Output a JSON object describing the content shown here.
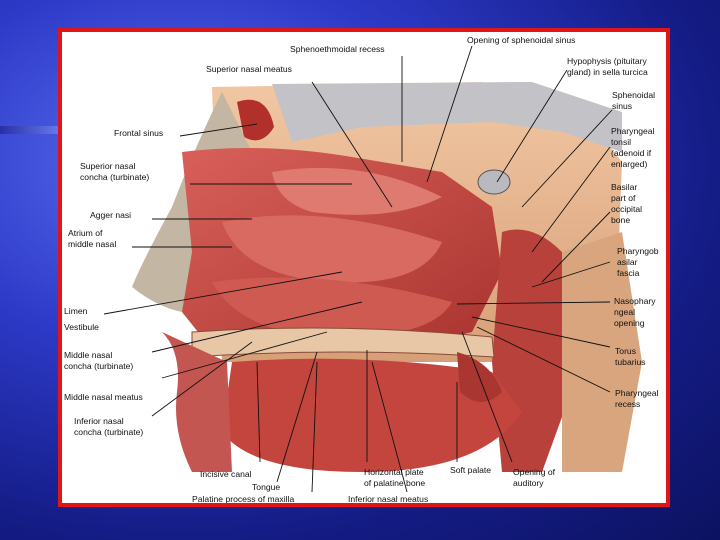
{
  "labels": {
    "sphenoethmoidal_recess": "Sphenoethmoidal recess",
    "opening_sphenoidal_sinus": "Opening of sphenoidal sinus",
    "superior_nasal_meatus": "Superior nasal meatus",
    "hypophysis": "Hypophysis (pituitary\ngland) in sella turcica",
    "sphenoidal_sinus": "Sphenoidal\nsinus",
    "frontal_sinus": "Frontal sinus",
    "pharyngeal_tonsil": "Pharyngeal\ntonsil\n(adenoid if\nenlarged)",
    "superior_nasal_concha": "Superior nasal\nconcha (turbinate)",
    "basilar_part": "Basilar\npart of\noccipital\nbone",
    "agger_nasi": "Agger nasi",
    "atrium_middle_nasal": "Atrium of\nmiddle nasal",
    "pharyngobasilar_fascia": "Pharyngob\nasilar\nfascia",
    "limen": "Limen",
    "vestibule": "Vestibule",
    "nasopharyngeal_opening": "Nasophary\nngeal\nopening",
    "middle_nasal_concha": "Middle nasal\nconcha (turbinate)",
    "torus_tubarius": "Torus\ntubarius",
    "middle_nasal_meatus": "Middle nasal meatus",
    "pharyngeal_recess": "Pharyngeal\nrecess",
    "inferior_nasal_concha": "Inferior nasal\nconcha (turbinate)",
    "incisive_canal": "Incisive canal",
    "tongue": "Tongue",
    "horizontal_plate": "Horizontal plate\nof palatine bone",
    "soft_palate": "Soft palate",
    "opening_auditory": "Opening of\nauditory",
    "palatine_process": "Palatine process of maxilla",
    "inferior_nasal_meatus": "Inferior nasal meatus"
  },
  "colors": {
    "frame_border": "#e01515",
    "background": "#1a2596",
    "tissue": "#c9433c",
    "bone": "#e9b48e"
  }
}
